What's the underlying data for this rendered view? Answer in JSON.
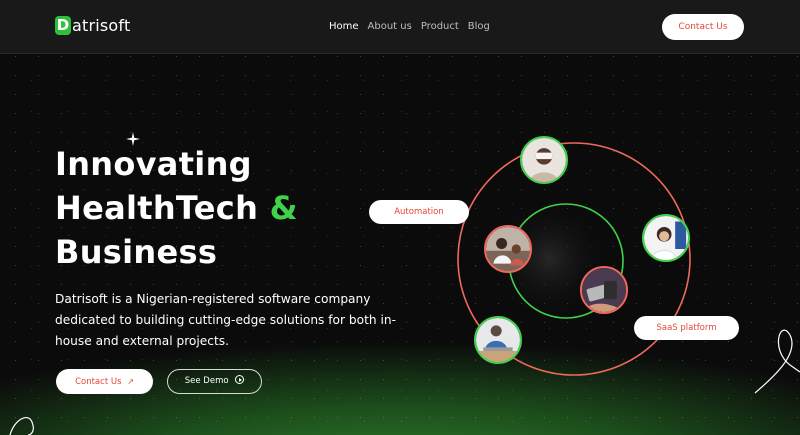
{
  "brand": {
    "logo_letter": "D",
    "logo_rest": "atrisoft",
    "accent": "#3fd24a",
    "cta_color": "#e4463a"
  },
  "nav": {
    "links": [
      {
        "label": "Home",
        "active": true
      },
      {
        "label": "About us",
        "active": false
      },
      {
        "label": "Product",
        "active": false
      },
      {
        "label": "Blog",
        "active": false
      }
    ],
    "cta": "Contact Us"
  },
  "hero": {
    "title_line1": "Innovating",
    "title_line2": "HealthTech",
    "title_amp": "&",
    "title_line3": "Business",
    "description": "Datrisoft is a Nigerian-registered software company dedicated to building cutting-edge solutions for both in-house and external projects.",
    "primary_cta": "Contact Us",
    "primary_cta_icon": "arrow-up-right-icon",
    "secondary_cta": "See Demo",
    "secondary_cta_icon": "play-circle-icon"
  },
  "orbit": {
    "tags": [
      "Automation",
      "SaaS platform"
    ],
    "avatars": [
      "vr-headset-user",
      "call-center-agent",
      "doctor-with-child",
      "card-payment",
      "laptop-worker"
    ]
  }
}
